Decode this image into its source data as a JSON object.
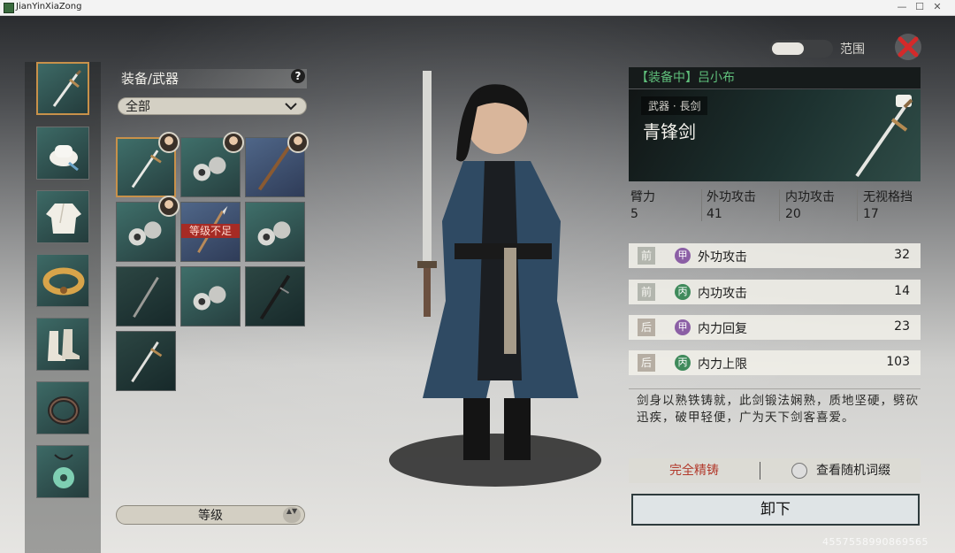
{
  "window": {
    "title": "JianYinXiaZong",
    "minimize": "—",
    "maximize": "☐",
    "close": "✕"
  },
  "categories": [
    {
      "name": "weapon",
      "active": true
    },
    {
      "name": "hat"
    },
    {
      "name": "robe"
    },
    {
      "name": "belt"
    },
    {
      "name": "boots"
    },
    {
      "name": "ring"
    },
    {
      "name": "pendant"
    }
  ],
  "inventory": {
    "title": "装备/武器",
    "help": "?",
    "filter": "全部",
    "level_warning": "等级不足",
    "sort_label": "等级",
    "sort_arrows": "▲▼"
  },
  "toggle": {
    "label": "范围"
  },
  "equipped": {
    "bar": "【装备中】吕小布",
    "type": "武器 · 長剑",
    "name": "青锋剑"
  },
  "stats": [
    {
      "label": "臂力",
      "value": "5"
    },
    {
      "label": "外功攻击",
      "value": "41"
    },
    {
      "label": "内功攻击",
      "value": "20"
    },
    {
      "label": "无视格挡",
      "value": "17"
    }
  ],
  "affixes": [
    {
      "pos": "前",
      "grade": "甲",
      "name": "外功攻击",
      "value": "32",
      "color": "#8b5fa5"
    },
    {
      "pos": "前",
      "grade": "丙",
      "name": "内功攻击",
      "value": "14",
      "color": "#3f8a5b"
    },
    {
      "pos": "后",
      "grade": "甲",
      "name": "内力回复",
      "value": "23",
      "color": "#8b5fa5"
    },
    {
      "pos": "后",
      "grade": "丙",
      "name": "内力上限",
      "value": "103",
      "color": "#3f8a5b"
    }
  ],
  "description": "剑身以熟铁铸就，此剑锻法娴熟，质地坚硬，劈砍迅疾，破甲轻便，广为天下剑客喜爱。",
  "actions": {
    "refine": "完全精铸",
    "view_affix": "查看随机词缀",
    "unequip": "卸下"
  },
  "uid": "4557558990869565"
}
